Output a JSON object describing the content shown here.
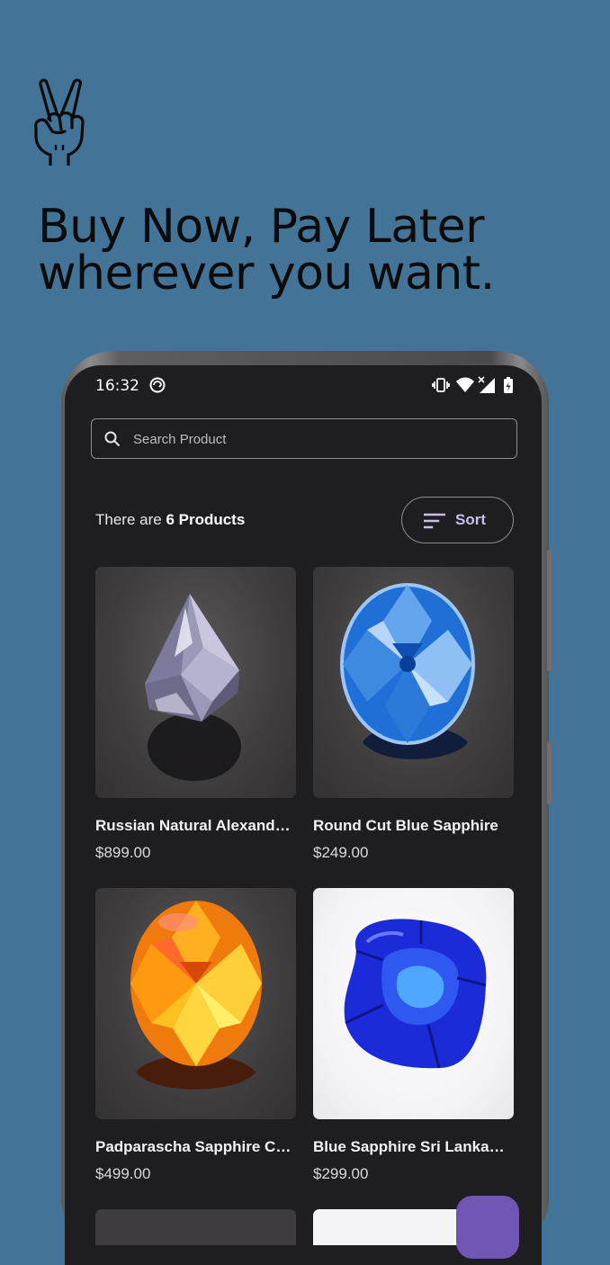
{
  "promo": {
    "headline_line1": "Buy Now, Pay Later",
    "headline_line2": "wherever you want.",
    "hand_icon": "peace-hand-icon"
  },
  "colors": {
    "background": "#437396",
    "screen": "#1e1d20",
    "accent": "#c9bdf2",
    "fab": "#6f56b5"
  },
  "status_bar": {
    "time": "16:32",
    "icons": [
      "sync-icon",
      "vibrate-icon",
      "wifi-icon",
      "signal-icon",
      "battery-icon"
    ]
  },
  "search": {
    "placeholder": "Search Product"
  },
  "summary": {
    "prefix": "There are",
    "count": "6 Products"
  },
  "sort_button": {
    "label": "Sort"
  },
  "products": [
    {
      "name": "Russian Natural Alexandrite",
      "price": "$899.00",
      "image": "alexandrite-gem"
    },
    {
      "name": "Round Cut Blue Sapphire",
      "price": "$249.00",
      "image": "blue-sapphire-gem"
    },
    {
      "name": "Padparascha Sapphire Ceylon",
      "price": "$499.00",
      "image": "padparascha-gem"
    },
    {
      "name": "Blue Sapphire Sri Lankan Cushion",
      "price": "$299.00",
      "image": "cushion-sapphire-gem"
    }
  ]
}
